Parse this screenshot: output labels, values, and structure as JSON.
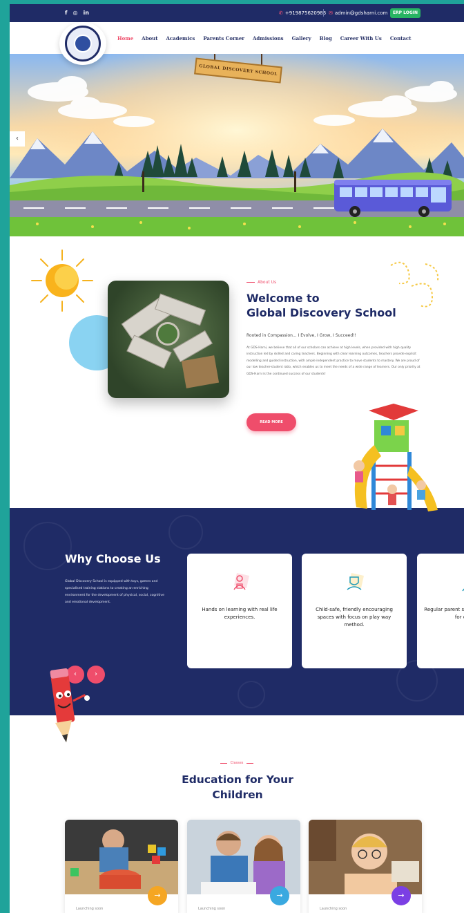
{
  "topbar": {
    "social": [
      "f",
      "◎",
      "in"
    ],
    "phone": "+919875620983",
    "email": "admin@gdsharni.com",
    "erp_label": "ERP LOGIN"
  },
  "nav": {
    "items": [
      "Home",
      "About",
      "Academics",
      "Parents Corner",
      "Admissions",
      "Gallery",
      "Blog",
      "Career With Us",
      "Contact"
    ],
    "active_index": 0
  },
  "hero": {
    "sign_text": "GLOBAL DISCOVERY SCHOOL"
  },
  "about": {
    "tag": "About Us",
    "title_line1": "Welcome to",
    "title_line2": "Global Discovery School",
    "subtitle": "Rooted in Compassion... I Evolve, I Grow, I Succeed!!",
    "body": "At GDS-Harni, we believe that all of our scholars can achieve at high levels, when provided with high quality instruction led by skilled and caring teachers. Beginning with clear learning outcomes, teachers provide explicit modelling and guided instruction, with ample independent practice to move students to mastery. We are proud of our low teacher-student ratio, which enables us to meet the needs of a wide range of learners. Our only priority at GDS-Harni is the continued success of our students!",
    "button": "READ MORE"
  },
  "why": {
    "title": "Why Choose Us",
    "body": "Global Discovery School is equipped with toys, games and specialised training stations to creating an enriching environment for the development of physical, social, cognitive and emotional development.",
    "cards": [
      {
        "text": "Hands on learning with real life experiences.",
        "icon": "hands-on-learning-icon"
      },
      {
        "text": "Child-safe, friendly encouraging spaces with focus on play way method.",
        "icon": "safe-space-icon"
      },
      {
        "text": "Regular parent sessions with updates for children.",
        "icon": "parent-session-icon"
      }
    ]
  },
  "classes": {
    "tag": "Classes",
    "title": "Education for Your Children",
    "cards": [
      {
        "label": "Launching soon",
        "accent": "#f5a623"
      },
      {
        "label": "Launching soon",
        "accent": "#3aa9e0"
      },
      {
        "label": "Launching soon",
        "accent": "#7b3fe4"
      }
    ]
  },
  "colors": {
    "navy": "#1f2b66",
    "pink": "#ef4d6b",
    "teal_frame": "#1fa39a"
  }
}
